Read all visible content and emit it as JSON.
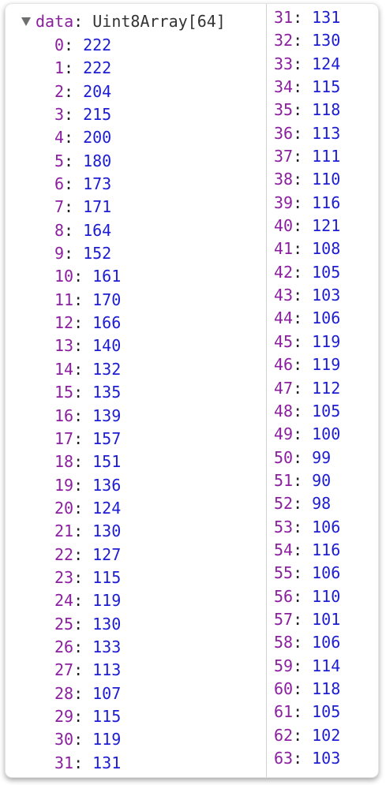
{
  "header": {
    "property": "data",
    "separator": ":",
    "type": "Uint8Array[64]",
    "toggle_icon": "disclosure-triangle-down-icon"
  },
  "colors": {
    "index": "#8b1f9f",
    "value": "#1c1cd4",
    "divider": "#d2d2d2"
  },
  "left_column": [
    {
      "i": "0",
      "v": "222"
    },
    {
      "i": "1",
      "v": "222"
    },
    {
      "i": "2",
      "v": "204"
    },
    {
      "i": "3",
      "v": "215"
    },
    {
      "i": "4",
      "v": "200"
    },
    {
      "i": "5",
      "v": "180"
    },
    {
      "i": "6",
      "v": "173"
    },
    {
      "i": "7",
      "v": "171"
    },
    {
      "i": "8",
      "v": "164"
    },
    {
      "i": "9",
      "v": "152"
    },
    {
      "i": "10",
      "v": "161"
    },
    {
      "i": "11",
      "v": "170"
    },
    {
      "i": "12",
      "v": "166"
    },
    {
      "i": "13",
      "v": "140"
    },
    {
      "i": "14",
      "v": "132"
    },
    {
      "i": "15",
      "v": "135"
    },
    {
      "i": "16",
      "v": "139"
    },
    {
      "i": "17",
      "v": "157"
    },
    {
      "i": "18",
      "v": "151"
    },
    {
      "i": "19",
      "v": "136"
    },
    {
      "i": "20",
      "v": "124"
    },
    {
      "i": "21",
      "v": "130"
    },
    {
      "i": "22",
      "v": "127"
    },
    {
      "i": "23",
      "v": "115"
    },
    {
      "i": "24",
      "v": "119"
    },
    {
      "i": "25",
      "v": "130"
    },
    {
      "i": "26",
      "v": "133"
    },
    {
      "i": "27",
      "v": "113"
    },
    {
      "i": "28",
      "v": "107"
    },
    {
      "i": "29",
      "v": "115"
    },
    {
      "i": "30",
      "v": "119"
    },
    {
      "i": "31",
      "v": "131"
    }
  ],
  "right_column": [
    {
      "i": "31",
      "v": "131"
    },
    {
      "i": "32",
      "v": "130"
    },
    {
      "i": "33",
      "v": "124"
    },
    {
      "i": "34",
      "v": "115"
    },
    {
      "i": "35",
      "v": "118"
    },
    {
      "i": "36",
      "v": "113"
    },
    {
      "i": "37",
      "v": "111"
    },
    {
      "i": "38",
      "v": "110"
    },
    {
      "i": "39",
      "v": "116"
    },
    {
      "i": "40",
      "v": "121"
    },
    {
      "i": "41",
      "v": "108"
    },
    {
      "i": "42",
      "v": "105"
    },
    {
      "i": "43",
      "v": "103"
    },
    {
      "i": "44",
      "v": "106"
    },
    {
      "i": "45",
      "v": "119"
    },
    {
      "i": "46",
      "v": "119"
    },
    {
      "i": "47",
      "v": "112"
    },
    {
      "i": "48",
      "v": "105"
    },
    {
      "i": "49",
      "v": "100"
    },
    {
      "i": "50",
      "v": "99"
    },
    {
      "i": "51",
      "v": "90"
    },
    {
      "i": "52",
      "v": "98"
    },
    {
      "i": "53",
      "v": "106"
    },
    {
      "i": "54",
      "v": "116"
    },
    {
      "i": "55",
      "v": "106"
    },
    {
      "i": "56",
      "v": "110"
    },
    {
      "i": "57",
      "v": "101"
    },
    {
      "i": "58",
      "v": "106"
    },
    {
      "i": "59",
      "v": "114"
    },
    {
      "i": "60",
      "v": "118"
    },
    {
      "i": "61",
      "v": "105"
    },
    {
      "i": "62",
      "v": "102"
    },
    {
      "i": "63",
      "v": "103"
    }
  ]
}
